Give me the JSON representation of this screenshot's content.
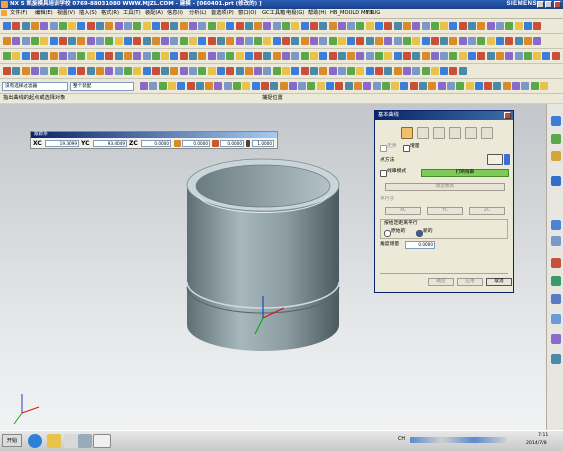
{
  "title": {
    "text": "NX 5  凯旋模具培训学校  0769-88031080  WWW.MJZL.COM - 建模 - [060401.prt  (修改的) ]",
    "brand": "SIEMENS"
  },
  "menu": [
    "文件(F)",
    "编辑(E)",
    "视图(V)",
    "插入(S)",
    "格式(R)",
    "工具(T)",
    "装配(A)",
    "信息(I)",
    "分析(L)",
    "首选项(P)",
    "窗口(O)",
    "GC工具箱",
    "电极(G)",
    "帮助(H)",
    "HB_MOULD M6.6",
    "YSUG"
  ],
  "filter": {
    "type_filter": "没有选择过滤器",
    "scope": "整个装配"
  },
  "hints": {
    "cue": "指出曲线的起点或选择对象",
    "status": "捕捉位置"
  },
  "coord": {
    "title": "跟踪条",
    "xc_label": "XC",
    "xc": "19.3099",
    "yc_label": "YC",
    "yc": "93.4049",
    "zc_label": "ZC",
    "zc": "0.0000",
    "f4": "0.0000",
    "f5": "0.0000",
    "f6": "1.0000"
  },
  "dialog": {
    "title": "基本曲线",
    "opt_infinite": "无界",
    "opt_incremental": "增量",
    "point_method_label": "点方法",
    "string_mode": "线串模式",
    "break_string": "打断线串",
    "lock_mode": "锁定模式",
    "parallel_label": "平行于",
    "xc": "XC",
    "yc": "YC",
    "zc": "ZC",
    "parallel_dist_label": "按给定距离平行",
    "original": "原始的",
    "new": "新的",
    "angle_inc_label": "角度增量",
    "angle_inc": "0.0000",
    "ok": "确定",
    "apply": "应用",
    "cancel": "取消"
  },
  "taskbar": {
    "start": "开始",
    "lang": "CH",
    "time": "7:11",
    "date": "2014/7/8"
  },
  "colors": {
    "accent": "#0a246a",
    "solid": "#95a7ad",
    "titlebar": "#2b5fb4"
  }
}
